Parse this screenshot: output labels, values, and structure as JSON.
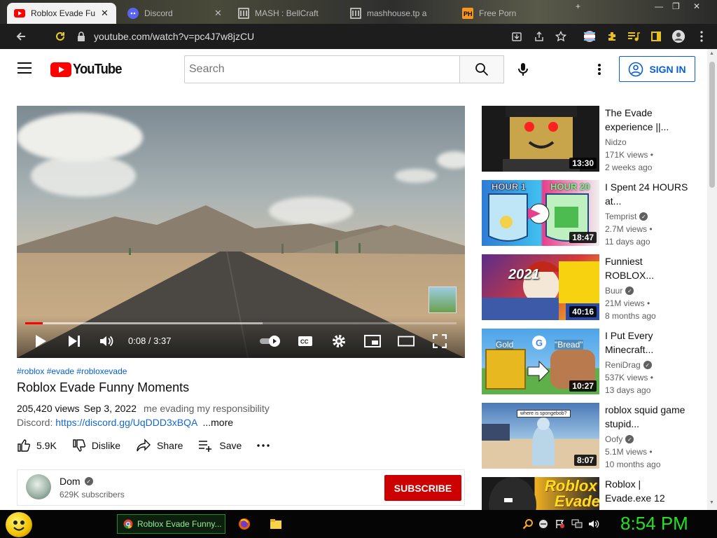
{
  "browser": {
    "tabs": [
      {
        "label": "Roblox Evade Fun",
        "icon": "youtube-icon",
        "active": true
      },
      {
        "label": "Discord",
        "icon": "discord-icon",
        "active": false
      },
      {
        "label": "MASH : BellCraft",
        "icon": "mash-icon",
        "active": false
      },
      {
        "label": "mashhouse.tp a",
        "icon": "mash-icon",
        "active": false
      },
      {
        "label": "Free Porn",
        "icon": "ph-icon",
        "active": false
      }
    ],
    "url": "youtube.com/watch?v=pc4J7w8jzCU"
  },
  "youtube": {
    "logo_text": "YouTube",
    "search_placeholder": "Search",
    "signin_label": "SIGN IN",
    "video": {
      "tags": "#roblox #evade #robloxevade",
      "title": "Roblox Evade Funny Moments",
      "views": "205,420 views",
      "date": "Sep 3, 2022",
      "description": "me evading my responsibility",
      "discord_label": "Discord:",
      "discord_link": "https://discord.gg/UqDDD3xBQA",
      "more_label": "...more",
      "time_current": "0:08",
      "time_total": "3:37",
      "progress": 0.04
    },
    "actions": {
      "likes": "5.9K",
      "dislike": "Dislike",
      "share": "Share",
      "save": "Save"
    },
    "channel": {
      "name": "Dom",
      "subscribers": "629K subscribers",
      "subscribe_label": "SUBSCRIBE"
    },
    "recommendations": [
      {
        "title": "The Evade experience ||...",
        "channel": "Nidzo",
        "verified": false,
        "views": "171K views",
        "age": "2 weeks ago",
        "duration": "13:30"
      },
      {
        "title": "I Spent 24 HOURS at...",
        "channel": "Temprist",
        "verified": true,
        "views": "2.7M views",
        "age": "11 days ago",
        "duration": "18:47",
        "thumb_text": [
          "HOUR 1",
          "HOUR 20"
        ]
      },
      {
        "title": "Funniest ROBLOX...",
        "channel": "Buur",
        "verified": true,
        "views": "21M views",
        "age": "8 months ago",
        "duration": "40:16",
        "thumb_text": [
          "2021"
        ]
      },
      {
        "title": "I Put Every Minecraft...",
        "channel": "ReniDrag",
        "verified": true,
        "views": "537K views",
        "age": "13 days ago",
        "duration": "10:27",
        "thumb_text": [
          "Gold",
          "\"Bread\""
        ]
      },
      {
        "title": "roblox squid game stupid...",
        "channel": "Oofy",
        "verified": true,
        "views": "5.1M views",
        "age": "10 months ago",
        "duration": "8:07",
        "thumb_text": [
          "where is spongebob?"
        ]
      },
      {
        "title": "Roblox | Evade.exe 12",
        "channel": "",
        "verified": false,
        "views": "",
        "age": "",
        "duration": "",
        "thumb_text": [
          "Roblox",
          "Evade"
        ]
      }
    ]
  },
  "taskbar": {
    "task_label": "Roblox Evade Funny...",
    "clock": "8:54 PM"
  },
  "colors": {
    "youtube_red": "#ff0000",
    "subscribe_red": "#cc0000",
    "link_blue": "#065fd4",
    "clock_green": "#22e022"
  }
}
